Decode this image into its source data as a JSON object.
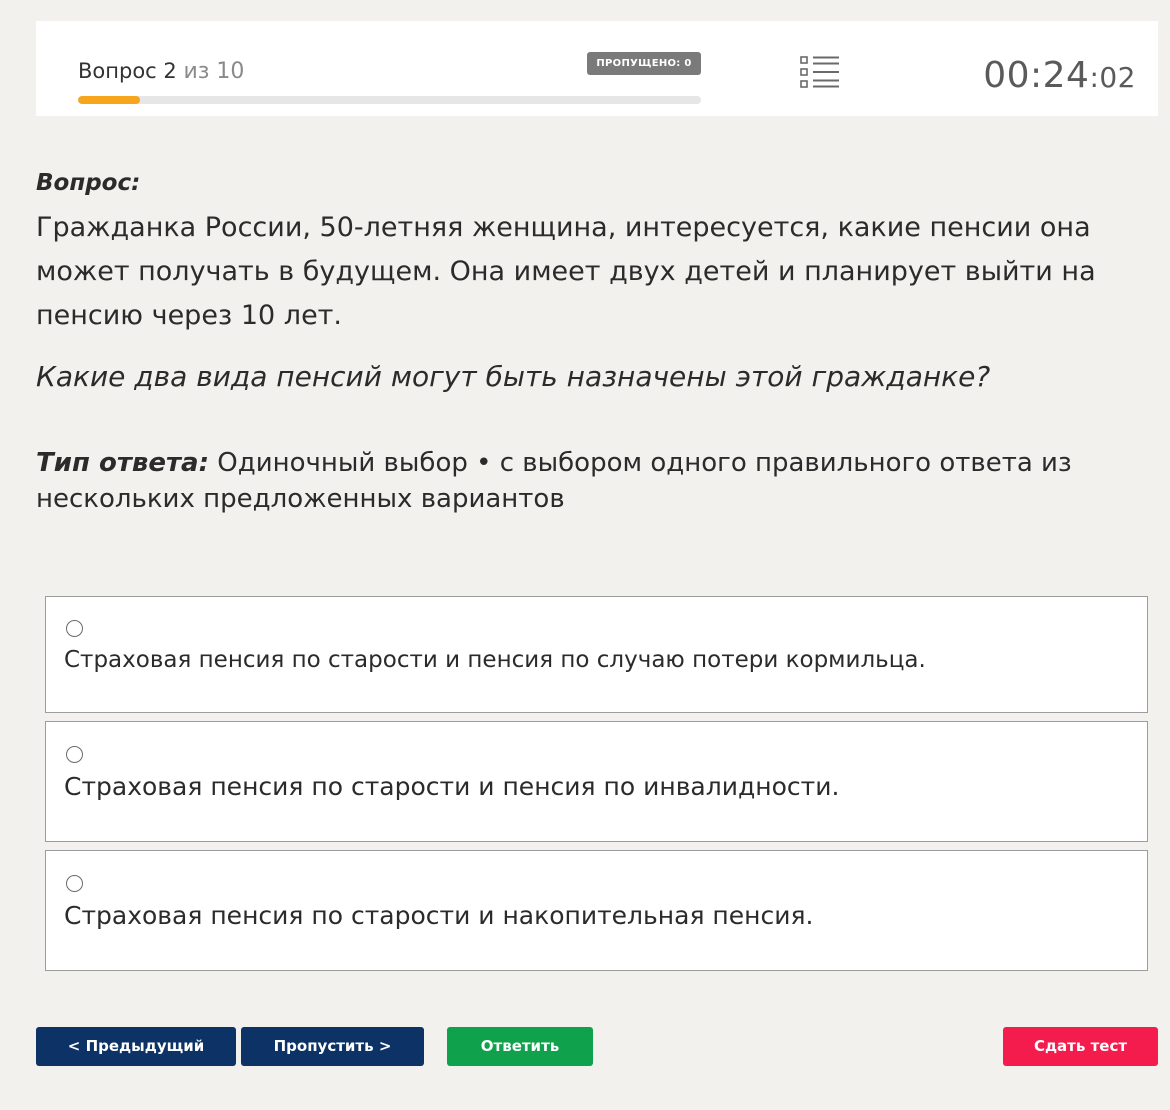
{
  "header": {
    "question_label": "Вопрос 2",
    "question_of": "из 10",
    "current": 2,
    "total": 10,
    "progress_percent": 10,
    "skipped_badge": "ПРОПУЩЕНО: 0",
    "timer_main": "00:24",
    "timer_seconds": ":02",
    "colors": {
      "progress": "#f7a51c",
      "badge": "#7a7a7a"
    }
  },
  "question": {
    "label": "Вопрос:",
    "text": "Гражданка России, 50-летняя женщина, интересуется, какие пенсии она может получать в будущем. Она имеет двух детей и планирует выйти на пенсию через 10 лет.",
    "ask": "Какие два вида пенсий могут быть назначены этой гражданке?",
    "answer_type_label": "Тип ответа:",
    "answer_type_value": "Одиночный выбор • с выбором одного правильного ответа из нескольких предложенных вариантов"
  },
  "options": [
    {
      "text": "Страховая пенсия по старости и пенсия по случаю потери кормильца.",
      "selected": false
    },
    {
      "text": "Страховая пенсия по старости и пенсия по инвалидности.",
      "selected": false
    },
    {
      "text": "Страховая пенсия по старости и накопительная пенсия.",
      "selected": false
    }
  ],
  "buttons": {
    "prev": "< Предыдущий",
    "skip": "Пропустить >",
    "answer": "Ответить",
    "submit": "Сдать тест",
    "colors": {
      "nav": "#0c3266",
      "answer": "#0fa14b",
      "submit": "#f41c4d"
    }
  },
  "icons": {
    "question_list": "list-icon",
    "radio": "radio-circle-icon"
  }
}
